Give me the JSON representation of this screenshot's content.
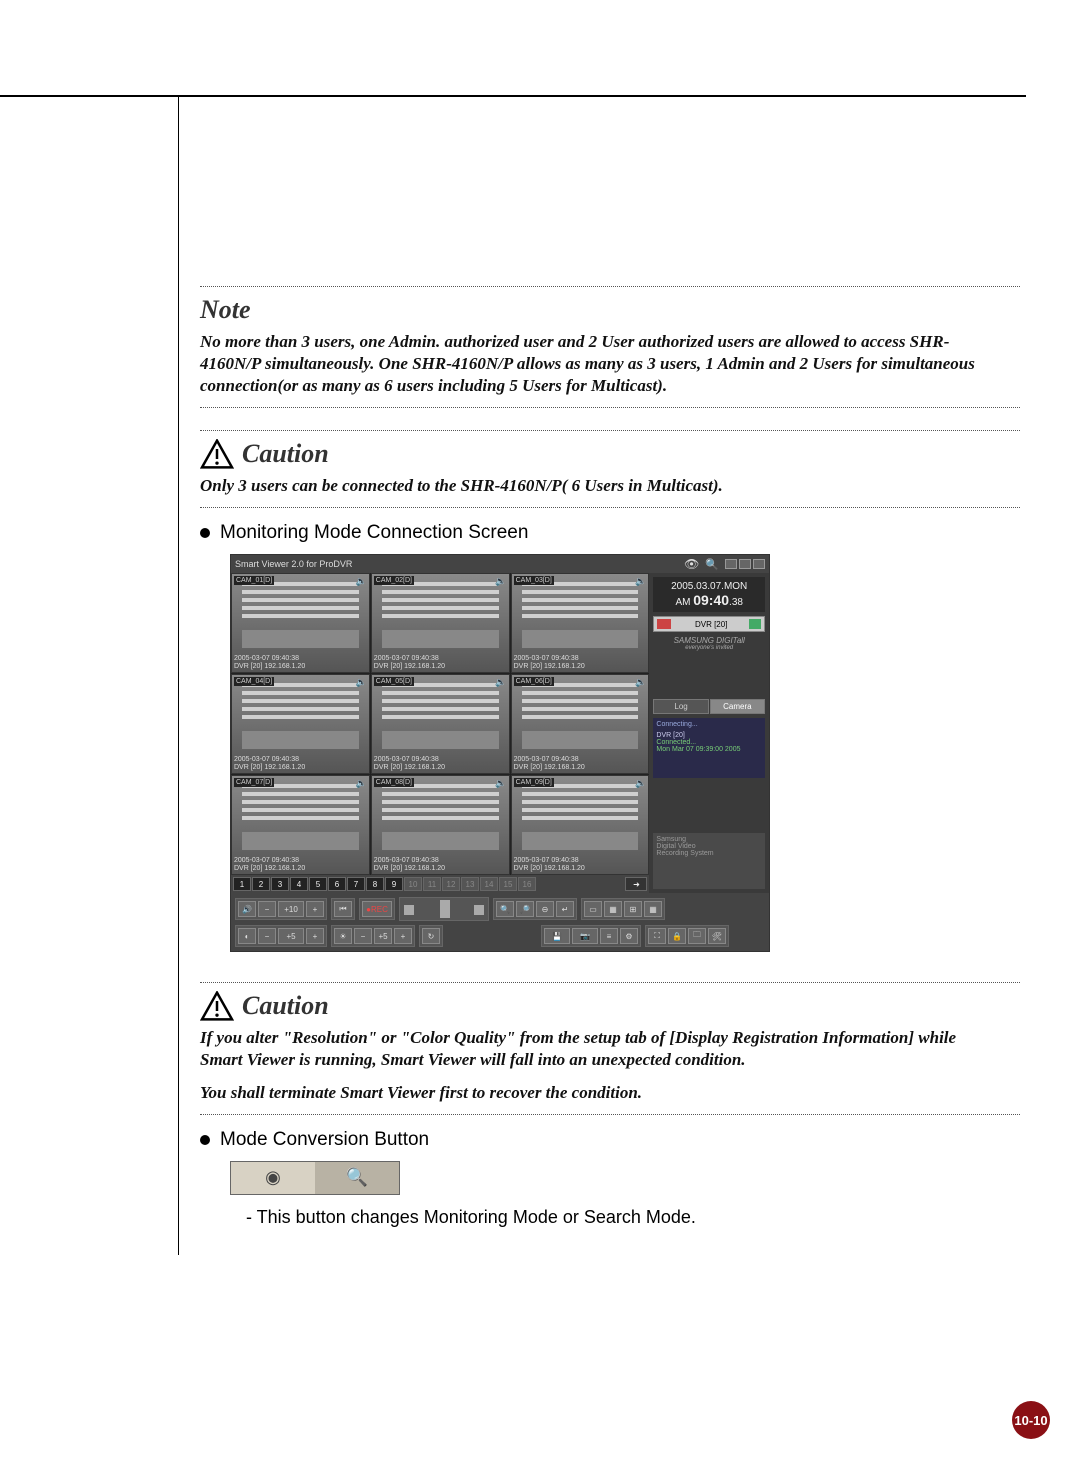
{
  "note": {
    "heading": "Note",
    "body": "No more than 3 users, one Admin. authorized user and 2 User authorized users are allowed to access SHR-4160N/P simultaneously. One SHR-4160N/P allows as many as 3 users, 1 Admin and 2 Users for simultaneous connection(or as many as 6 users including 5 Users for Multicast)."
  },
  "caution1": {
    "heading": "Caution",
    "body": "Only 3 users can be connected to the SHR-4160N/P( 6 Users in Multicast)."
  },
  "bullet1": "Monitoring Mode Connection Screen",
  "screenshot": {
    "title": "Smart Viewer 2.0 for ProDVR",
    "datetime_date": "2005.03.07.MON",
    "datetime_ampm": "AM",
    "datetime_time": "09:40",
    "datetime_sec": ".38",
    "dvr_sel": "DVR [20]",
    "brand": "SAMSUNG DIGITall",
    "brand_sub": "everyone's invited",
    "tabs": {
      "log": "Log",
      "camera": "Camera"
    },
    "log_connecting": "Connecting...",
    "log_dvr": "DVR [20]",
    "log_status": "Connected...",
    "log_time": "Mon Mar 07 09:39:00 2005",
    "footer1": "Samsung",
    "footer2": "Digital Video",
    "footer3": "Recording System",
    "cams": [
      {
        "label": "CAM_01[D]",
        "ts1": "2005-03-07 09:40:38",
        "ts2": "DVR [20] 192.168.1.20"
      },
      {
        "label": "CAM_02[D]",
        "ts1": "2005-03-07 09:40:38",
        "ts2": "DVR [20] 192.168.1.20"
      },
      {
        "label": "CAM_03[D]",
        "ts1": "2005-03-07 09:40:38",
        "ts2": "DVR [20] 192.168.1.20"
      },
      {
        "label": "CAM_04[D]",
        "ts1": "2005-03-07 09:40:38",
        "ts2": "DVR [20] 192.168.1.20"
      },
      {
        "label": "CAM_05[D]",
        "ts1": "2005-03-07 09:40:38",
        "ts2": "DVR [20] 192.168.1.20"
      },
      {
        "label": "CAM_06[D]",
        "ts1": "2005-03-07 09:40:38",
        "ts2": "DVR [20] 192.168.1.20"
      },
      {
        "label": "CAM_07[D]",
        "ts1": "2005-03-07 09:40:38",
        "ts2": "DVR [20] 192.168.1.20"
      },
      {
        "label": "CAM_08[D]",
        "ts1": "2005-03-07 09:40:38",
        "ts2": "DVR [20] 192.168.1.20"
      },
      {
        "label": "CAM_09[D]",
        "ts1": "2005-03-07 09:40:38",
        "ts2": "DVR [20] 192.168.1.20"
      }
    ],
    "channels_on": [
      "1",
      "2",
      "3",
      "4",
      "5",
      "6",
      "7",
      "8",
      "9"
    ],
    "channels_off": [
      "10",
      "11",
      "12",
      "13",
      "14",
      "15",
      "16"
    ],
    "zoom_plus10": "+10",
    "zoom_plus5": "+5"
  },
  "caution2": {
    "heading": "Caution",
    "body1": "If you alter \"Resolution\" or \"Color Quality\" from the setup tab of [Display Registration Information] while Smart Viewer is running, Smart Viewer will fall into an unexpected condition.",
    "body2": "You shall terminate Smart Viewer first to recover the condition."
  },
  "bullet2": "Mode Conversion Button",
  "mode_desc": "- This button changes Monitoring Mode or Search Mode.",
  "page_number": "10-10"
}
